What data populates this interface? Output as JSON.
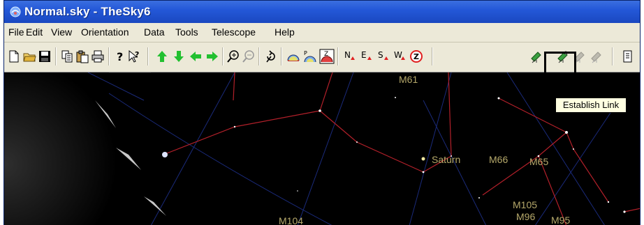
{
  "window": {
    "title": "Normal.sky - TheSky6"
  },
  "menu": [
    "File",
    "Edit",
    "View",
    "Orientation",
    "Data",
    "Tools",
    "Telescope",
    "Help"
  ],
  "tooltip": {
    "text": "Establish Link"
  },
  "sky": {
    "labels": {
      "m61": "M61",
      "saturn": "Saturn",
      "m66": "M66",
      "m65": "M65",
      "m105": "M105",
      "m96": "M96",
      "m95": "M95",
      "m104": "M104"
    }
  },
  "colors": {
    "title_bar": "#2458d8",
    "menu_bg": "#ece9d8",
    "sky_bg": "#000000",
    "constellation_line": "#b3202a",
    "grid_line": "#1a2a7a",
    "object_label": "#b5a86a",
    "tooltip_bg": "#ffffe1"
  }
}
